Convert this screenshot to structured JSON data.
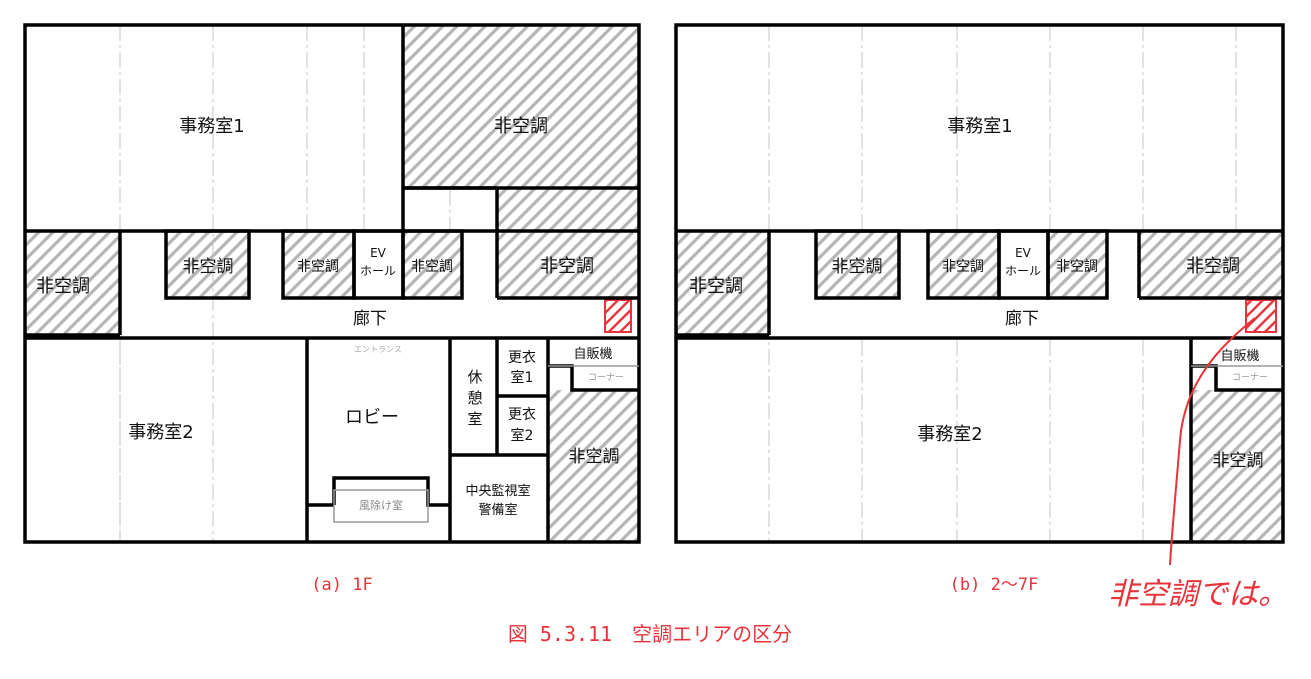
{
  "figure": {
    "caption": "図 5.3.11　空調エリアの区分",
    "red_color": "#e8333a",
    "hatch_color": "#b5b5b5"
  },
  "floor_1f": {
    "sublabel": "(a)  1F",
    "office1": "事務室1",
    "office2": "事務室2",
    "non_ac": "非空調",
    "ev_line1": "EV",
    "ev_line2": "ホール",
    "corridor": "廊下",
    "lobby": "ロビー",
    "rest_line1": "休",
    "rest_line2": "憩",
    "rest_line3": "室",
    "locker1_line1": "更衣",
    "locker1_line2": "室1",
    "locker2_line1": "更衣",
    "locker2_line2": "室2",
    "vending": "自販機",
    "vending_corner": "コーナー",
    "control_line1": "中央監視室",
    "control_line2": "警備室",
    "windbreak": "風除け室",
    "lobby_faint": "エントランス"
  },
  "floor_2_7f": {
    "sublabel": "(b)  2～7F",
    "office1": "事務室1",
    "office2": "事務室2",
    "non_ac": "非空調",
    "ev_line1": "EV",
    "ev_line2": "ホール",
    "corridor": "廊下",
    "vending": "自販機",
    "vending_corner": "コーナー"
  },
  "annotation": {
    "handwritten_note": "非空調では。"
  }
}
